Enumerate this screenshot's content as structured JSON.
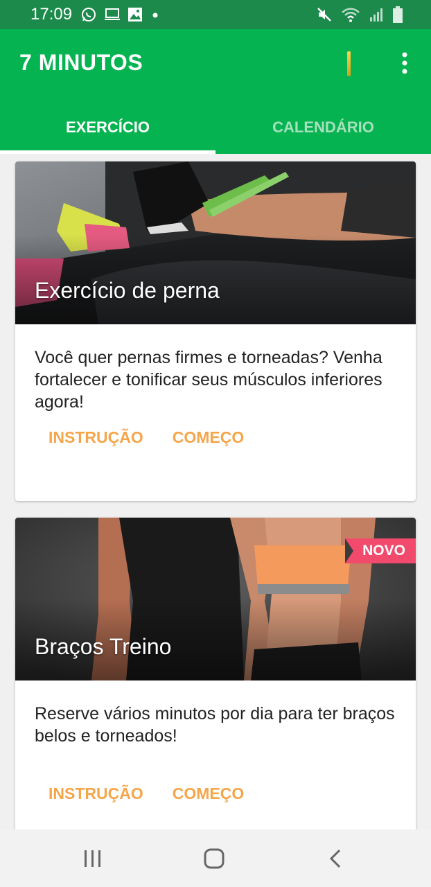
{
  "status_bar": {
    "time": "17:09",
    "left_icons": [
      "whatsapp-icon",
      "laptop-icon",
      "image-icon",
      "dot-icon"
    ],
    "right_icons": [
      "mute-icon",
      "wifi-icon",
      "signal-icon",
      "battery-icon"
    ]
  },
  "app_bar": {
    "title": "7 MINUTOS",
    "menu_icon": "more-vert-icon"
  },
  "tabs": [
    {
      "label": "EXERCÍCIO",
      "active": true
    },
    {
      "label": "CALENDÁRIO",
      "active": false
    }
  ],
  "cards": [
    {
      "title": "Exercício de perna",
      "description": "Você quer pernas firmes e torneadas? Venha fortalecer e tonificar seus músculos inferiores agora!",
      "actions": [
        "INSTRUÇÃO",
        "COMEÇO"
      ]
    },
    {
      "title": "Braços Treino",
      "badge": "NOVO",
      "description": "Reserve vários minutos por dia para ter braços belos e torneados!",
      "actions": [
        "INSTRUÇÃO",
        "COMEÇO"
      ]
    }
  ],
  "nav_bar": [
    "recent-apps-icon",
    "home-icon",
    "back-icon"
  ],
  "colors": {
    "status_bar": "#1b8a4a",
    "app_bar": "#06b351",
    "action": "#f5a54a",
    "badge": "#f24a6c"
  }
}
